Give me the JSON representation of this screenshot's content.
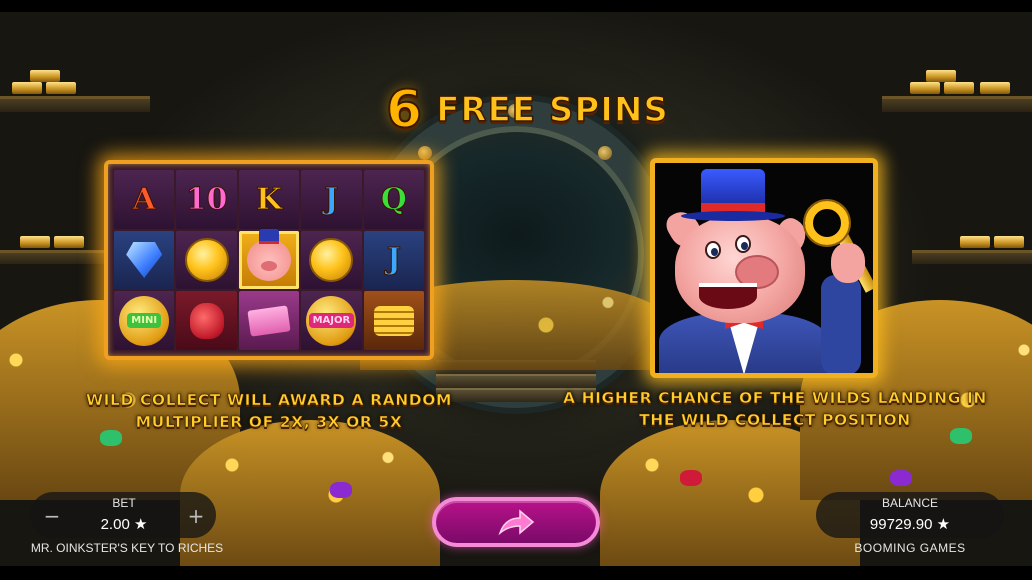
{
  "game": {
    "title_number": "6",
    "title_text": "FREE SPINS"
  },
  "grid": {
    "rows": [
      [
        "A",
        "10",
        "K",
        "J",
        "Q"
      ],
      [
        "diamond",
        "coin",
        "wild-pig",
        "coin",
        "J"
      ],
      [
        "MINI",
        "money-bag",
        "cash",
        "MAJOR",
        "coin-stack"
      ]
    ],
    "badges": {
      "mini": "MINI",
      "major": "MAJOR"
    }
  },
  "captions": {
    "left_line1": "WILD COLLECT WILL AWARD A RANDOM",
    "left_line2": "MULTIPLIER OF 2X, 3X OR 5X",
    "right_line1": "A HIGHER CHANCE OF THE WILDS LANDING IN",
    "right_line2": "THE WILD COLLECT POSITION"
  },
  "hud": {
    "bet_label": "BET",
    "bet_value": "2.00 ★",
    "minus": "−",
    "plus": "+",
    "game_name": "MR. OINKSTER'S KEY TO RICHES",
    "balance_label": "BALANCE",
    "balance_value": "99729.90 ★",
    "provider": "BOOMING GAMES"
  },
  "icons": {
    "continue": "arrow-right-icon",
    "currency": "star-icon"
  },
  "colors": {
    "accent_gold": "#ffc21a",
    "button_pink": "#b8128a",
    "frame_orange": "#f0a020"
  }
}
